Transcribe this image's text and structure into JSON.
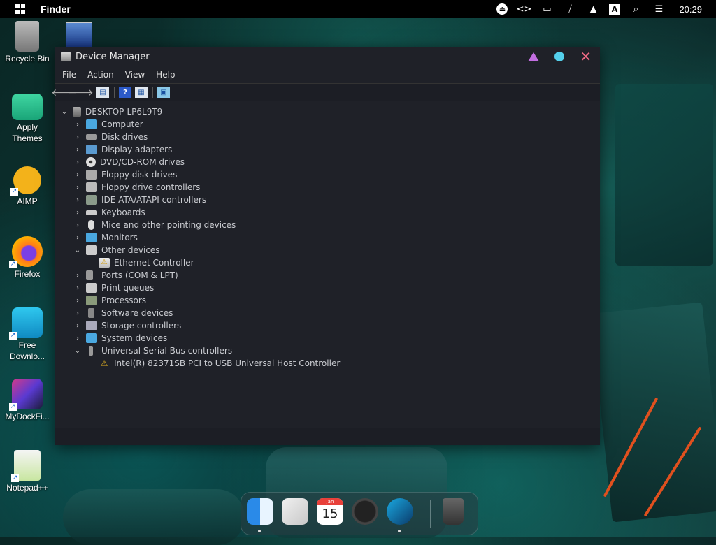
{
  "menubar": {
    "app_name": "Finder",
    "clock": "20:29",
    "tray_icons": [
      "eject-icon",
      "code-icon",
      "monitor-icon",
      "mute-icon",
      "upload-icon",
      "keyboard-layout-icon",
      "search-icon",
      "control-center-icon"
    ],
    "keyboard_letter": "A"
  },
  "desktop": {
    "icons": [
      {
        "label": "Recycle Bin",
        "icon": "recycle-bin-icon"
      },
      {
        "label": "Apply Themes",
        "icon": "folder-icon"
      },
      {
        "label": "AIMP",
        "icon": "aimp-icon"
      },
      {
        "label": "Firefox",
        "icon": "firefox-icon"
      },
      {
        "label": "Free Downlo...",
        "icon": "download-manager-icon"
      },
      {
        "label": "MyDockFi...",
        "icon": "mydockfinder-icon"
      },
      {
        "label": "Notepad++",
        "icon": "notepadpp-icon"
      }
    ]
  },
  "window": {
    "title": "Device Manager",
    "menus": [
      "File",
      "Action",
      "View",
      "Help"
    ],
    "tree": {
      "root": "DESKTOP-LP6L9T9",
      "items": [
        {
          "label": "Computer",
          "expanded": false
        },
        {
          "label": "Disk drives",
          "expanded": false
        },
        {
          "label": "Display adapters",
          "expanded": false
        },
        {
          "label": "DVD/CD-ROM drives",
          "expanded": false
        },
        {
          "label": "Floppy disk drives",
          "expanded": false
        },
        {
          "label": "Floppy drive controllers",
          "expanded": false
        },
        {
          "label": "IDE ATA/ATAPI controllers",
          "expanded": false
        },
        {
          "label": "Keyboards",
          "expanded": false
        },
        {
          "label": "Mice and other pointing devices",
          "expanded": false
        },
        {
          "label": "Monitors",
          "expanded": false
        },
        {
          "label": "Other devices",
          "expanded": true,
          "children": [
            "Ethernet Controller"
          ]
        },
        {
          "label": "Ports (COM & LPT)",
          "expanded": false
        },
        {
          "label": "Print queues",
          "expanded": false
        },
        {
          "label": "Processors",
          "expanded": false
        },
        {
          "label": "Software devices",
          "expanded": false
        },
        {
          "label": "Storage controllers",
          "expanded": false
        },
        {
          "label": "System devices",
          "expanded": false
        },
        {
          "label": "Universal Serial Bus controllers",
          "expanded": true,
          "children": [
            "Intel(R) 82371SB PCI to USB Universal Host Controller"
          ]
        }
      ]
    }
  },
  "dock": {
    "items": [
      "finder-icon",
      "launchpad-icon",
      "calendar-icon",
      "clock-icon",
      "app-arrow-icon",
      "trash-icon"
    ],
    "calendar_month": "Jan",
    "calendar_day": "15"
  },
  "colors": {
    "window_bg": "#1f2128",
    "minimize": "#c26ee0",
    "maximize": "#54d0ec",
    "close": "#ef6a84"
  }
}
